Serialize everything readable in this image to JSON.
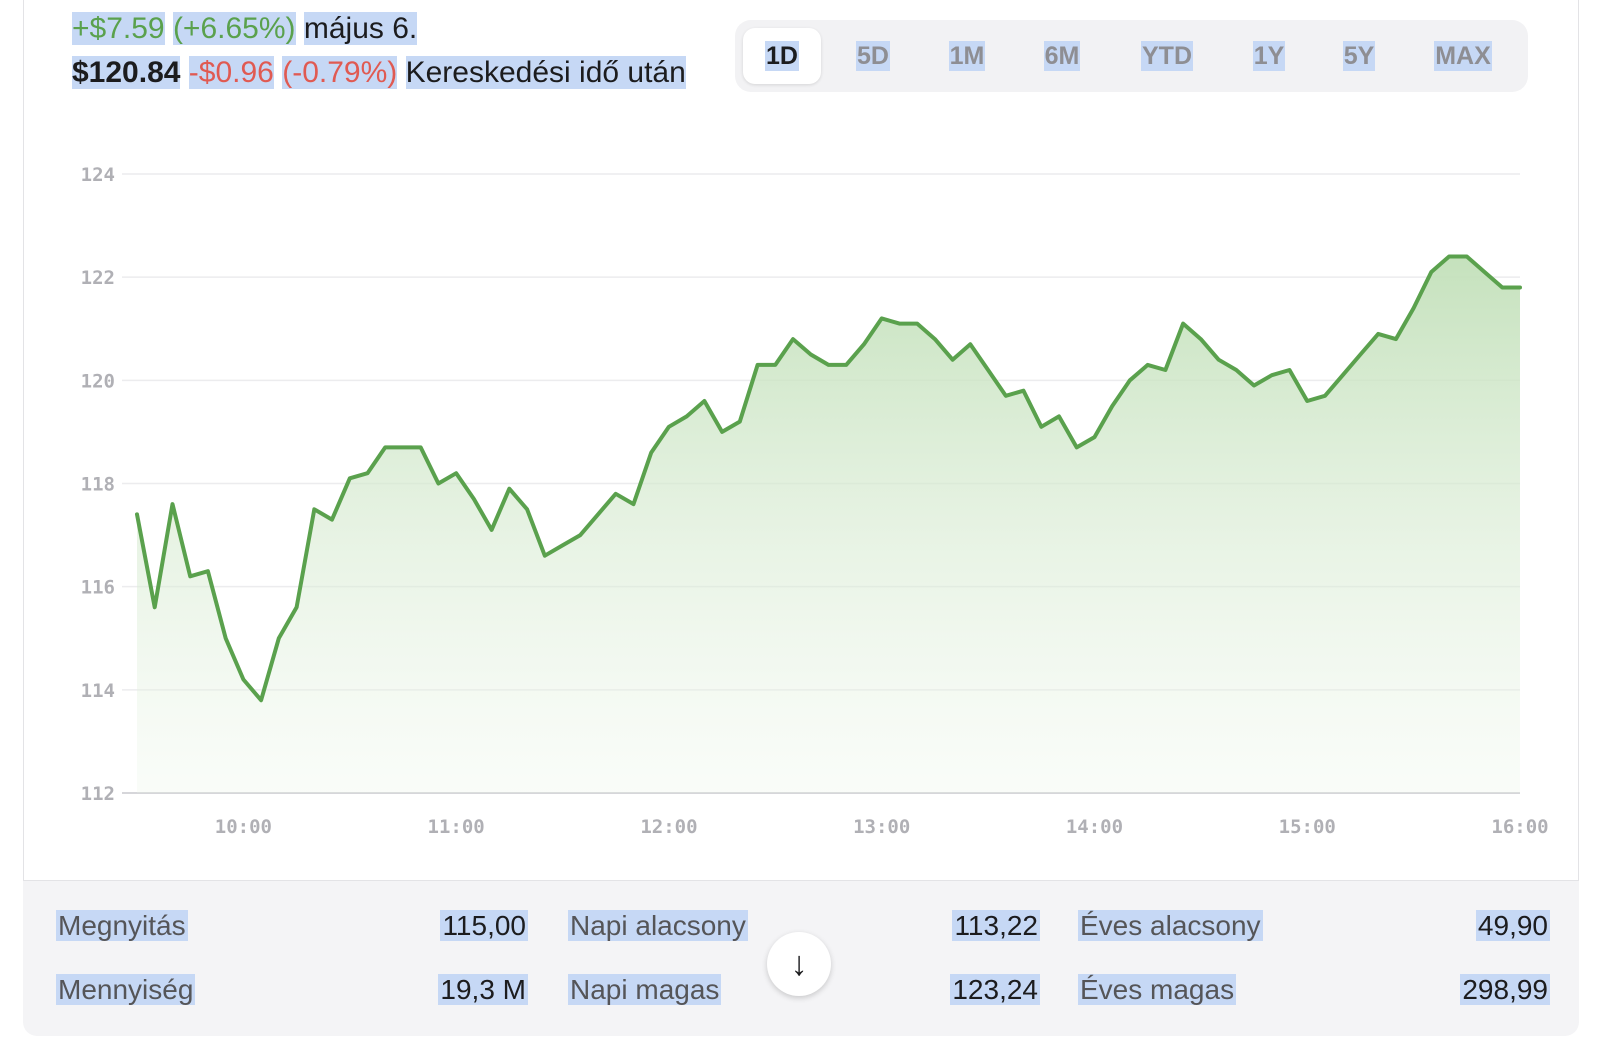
{
  "quote": {
    "change_abs": "+$7.59",
    "change_pct": "(+6.65%)",
    "date": "május 6.",
    "after_price": "$120.84",
    "after_change_abs": "-$0.96",
    "after_change_pct": "(-0.79%)",
    "after_label": "Kereskedési idő után"
  },
  "ranges": [
    "1D",
    "5D",
    "1M",
    "6M",
    "YTD",
    "1Y",
    "5Y",
    "MAX"
  ],
  "active_range": "1D",
  "stats": {
    "open_label": "Megnyitás",
    "open_value": "115,00",
    "volume_label": "Mennyiség",
    "volume_value": "19,3 M",
    "day_low_label": "Napi alacsony",
    "day_low_value": "113,22",
    "day_high_label": "Napi magas",
    "day_high_value": "123,24",
    "year_low_label": "Éves alacsony",
    "year_low_value": "49,90",
    "year_high_label": "Éves magas",
    "year_high_value": "298,99"
  },
  "colors": {
    "line": "#5aa14d",
    "fill": "#cfe6c8",
    "grid": "#ececee"
  },
  "chart_data": {
    "type": "area",
    "ylim": [
      112,
      124
    ],
    "yticks": [
      "112",
      "114",
      "116",
      "118",
      "120",
      "122",
      "124"
    ],
    "xticks": [
      "10:00",
      "11:00",
      "12:00",
      "13:00",
      "14:00",
      "15:00",
      "16:00"
    ],
    "xlim": [
      "09:30",
      "16:00"
    ],
    "x": [
      "09:30",
      "09:35",
      "09:40",
      "09:45",
      "09:50",
      "09:55",
      "10:00",
      "10:05",
      "10:10",
      "10:15",
      "10:20",
      "10:25",
      "10:30",
      "10:35",
      "10:40",
      "10:45",
      "10:50",
      "10:55",
      "11:00",
      "11:05",
      "11:10",
      "11:15",
      "11:20",
      "11:25",
      "11:30",
      "11:35",
      "11:40",
      "11:45",
      "11:50",
      "11:55",
      "12:00",
      "12:05",
      "12:10",
      "12:15",
      "12:20",
      "12:25",
      "12:30",
      "12:35",
      "12:40",
      "12:45",
      "12:50",
      "12:55",
      "13:00",
      "13:05",
      "13:10",
      "13:15",
      "13:20",
      "13:25",
      "13:30",
      "13:35",
      "13:40",
      "13:45",
      "13:50",
      "13:55",
      "14:00",
      "14:05",
      "14:10",
      "14:15",
      "14:20",
      "14:25",
      "14:30",
      "14:35",
      "14:40",
      "14:45",
      "14:50",
      "14:55",
      "15:00",
      "15:05",
      "15:10",
      "15:15",
      "15:20",
      "15:25",
      "15:30",
      "15:35",
      "15:40",
      "15:45",
      "15:50",
      "15:55",
      "16:00"
    ],
    "values": [
      117.4,
      115.6,
      117.6,
      116.2,
      116.3,
      115.0,
      114.2,
      113.8,
      115.0,
      115.6,
      117.5,
      117.3,
      118.1,
      118.2,
      118.7,
      118.7,
      118.7,
      118.0,
      118.2,
      117.7,
      117.1,
      117.9,
      117.5,
      116.6,
      116.8,
      117.0,
      117.4,
      117.8,
      117.6,
      118.6,
      119.1,
      119.3,
      119.6,
      119.0,
      119.2,
      120.3,
      120.3,
      120.8,
      120.5,
      120.3,
      120.3,
      120.7,
      121.2,
      121.1,
      121.1,
      120.8,
      120.4,
      120.7,
      120.2,
      119.7,
      119.8,
      119.1,
      119.3,
      118.7,
      118.9,
      119.5,
      120.0,
      120.3,
      120.2,
      121.1,
      120.8,
      120.4,
      120.2,
      119.9,
      120.1,
      120.2,
      119.6,
      119.7,
      120.1,
      120.5,
      120.9,
      120.8,
      121.4,
      122.1,
      122.4,
      122.4,
      122.1,
      121.8,
      121.8
    ]
  }
}
